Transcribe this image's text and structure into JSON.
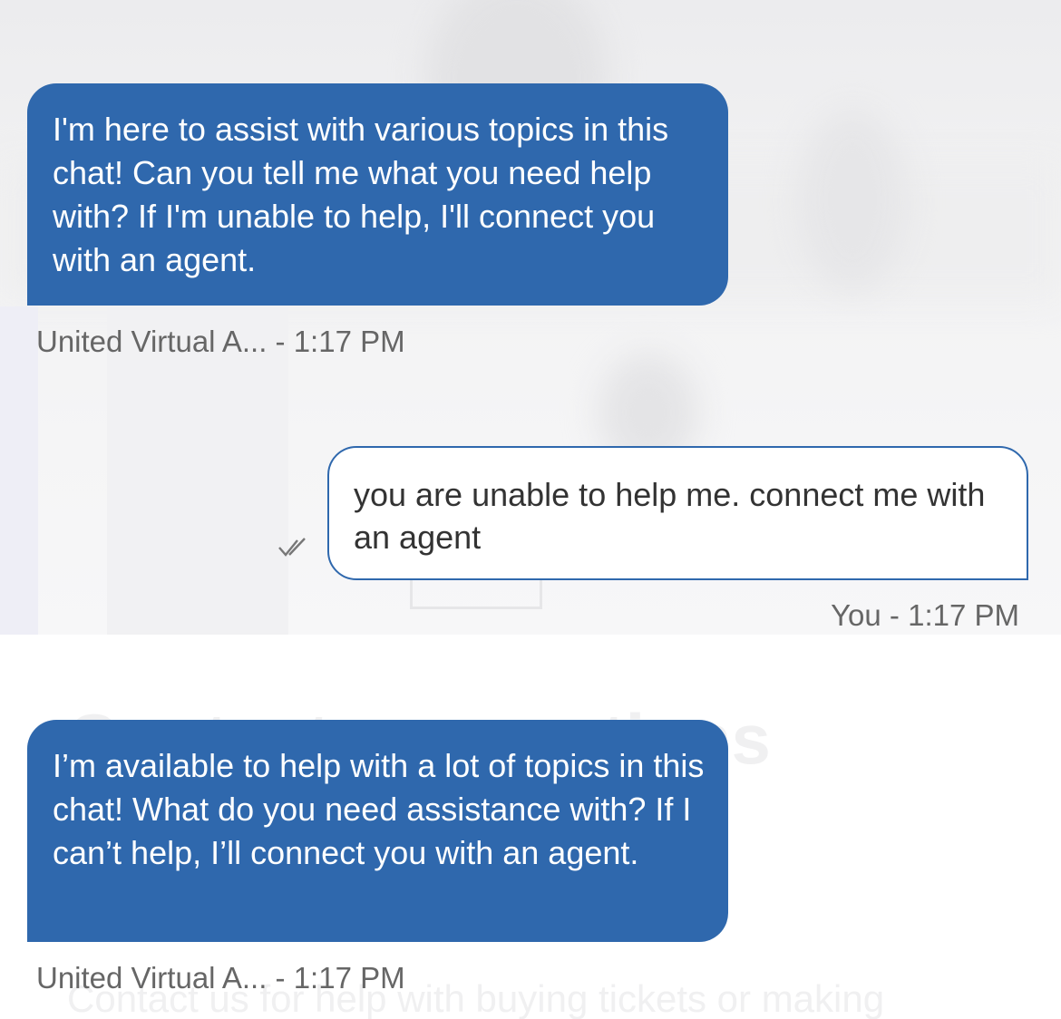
{
  "background": {
    "heading": "Contact reservations directory",
    "subtext": "Contact us for help with buying tickets or making"
  },
  "messages": [
    {
      "sender": "bot",
      "text": "I'm here to assist with various topics in this chat! Can you tell me what you need help with? If I'm unable to help, I'll connect you with an agent.",
      "meta": "United Virtual A... - 1:17 PM"
    },
    {
      "sender": "user",
      "text": "you are unable to help me. connect me with an agent",
      "meta": "You - 1:17 PM",
      "status_icon": "double-check-icon"
    },
    {
      "sender": "bot",
      "text": "I’m available to help with a lot of topics in this chat! What do you need assistance with? If I can’t help, I’ll connect you with an agent.",
      "meta": "United Virtual A... - 1:17 PM"
    }
  ],
  "colors": {
    "bot_bubble": "#2f68ad",
    "user_bubble_border": "#2f68ad",
    "meta_text": "#666666"
  }
}
